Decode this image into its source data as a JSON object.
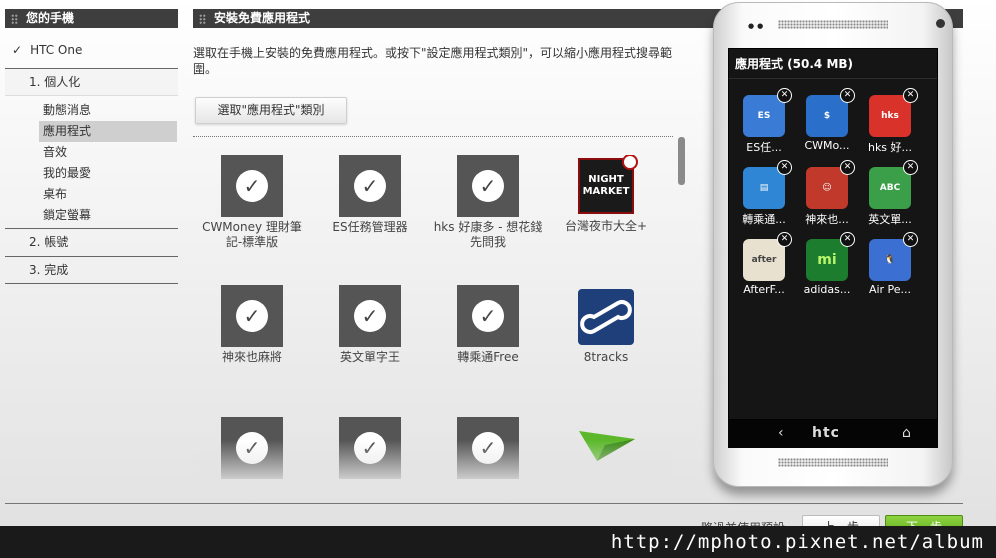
{
  "sidebar": {
    "header": "您的手機",
    "device": "HTC One",
    "steps": [
      {
        "label": "1. 個人化"
      },
      {
        "label": "2. 帳號"
      },
      {
        "label": "3. 完成"
      }
    ],
    "subitems": [
      "動態消息",
      "應用程式",
      "音效",
      "我的最愛",
      "桌布",
      "鎖定螢幕"
    ],
    "selected_subitem": "應用程式"
  },
  "main": {
    "header": "安裝免費應用程式",
    "description": "選取在手機上安裝的免費應用程式。或按下\"設定應用程式類別\"，可以縮小應用程式搜尋範圍。",
    "category_button": "選取\"應用程式\"類別",
    "apps": [
      {
        "name": "CWMoney 理財筆記-標準版",
        "checked": true
      },
      {
        "name": "ES任務管理器",
        "checked": true
      },
      {
        "name": "hks 好康多 - 想花錢 先問我",
        "checked": true
      },
      {
        "name": "台灣夜市大全+",
        "checked": false,
        "icon": "night-market-icon"
      },
      {
        "name": "神來也麻將",
        "checked": true
      },
      {
        "name": "英文單字王",
        "checked": true
      },
      {
        "name": "轉乘通Free",
        "checked": true
      },
      {
        "name": "8tracks",
        "checked": false,
        "icon": "8tracks-icon"
      },
      {
        "name": "",
        "checked": true
      },
      {
        "name": "",
        "checked": true
      },
      {
        "name": "",
        "checked": true
      },
      {
        "name": "",
        "checked": false,
        "icon": "paper-plane-icon"
      }
    ]
  },
  "footer_nav": {
    "skip": "略過並使用預設",
    "prev": "上一步",
    "next": "下一步"
  },
  "phone": {
    "screen_title": "應用程式 (50.4 MB)",
    "brand": "htc",
    "apps": [
      {
        "name": "ES任...",
        "icon": "es-task-icon",
        "color": "#3a7bd5"
      },
      {
        "name": "CWMo...",
        "icon": "cwmoney-icon",
        "color": "#2a6fc9"
      },
      {
        "name": "hks 好...",
        "icon": "hks-icon",
        "color": "#d9322b"
      },
      {
        "name": "轉乘通...",
        "icon": "transfer-icon",
        "color": "#2e86d4"
      },
      {
        "name": "神來也...",
        "icon": "mahjong-icon",
        "color": "#c0392b"
      },
      {
        "name": "英文單...",
        "icon": "english-word-icon",
        "color": "#3b9f4a"
      },
      {
        "name": "AfterF...",
        "icon": "afterfocus-icon",
        "color": "#e9e1cf"
      },
      {
        "name": "adidas...",
        "icon": "adidas-mi-icon",
        "color": "#1c7d2f"
      },
      {
        "name": "Air Pe...",
        "icon": "air-penguin-icon",
        "color": "#3b6fd1"
      }
    ]
  },
  "watermark": "http://mphoto.pixnet.net/album"
}
